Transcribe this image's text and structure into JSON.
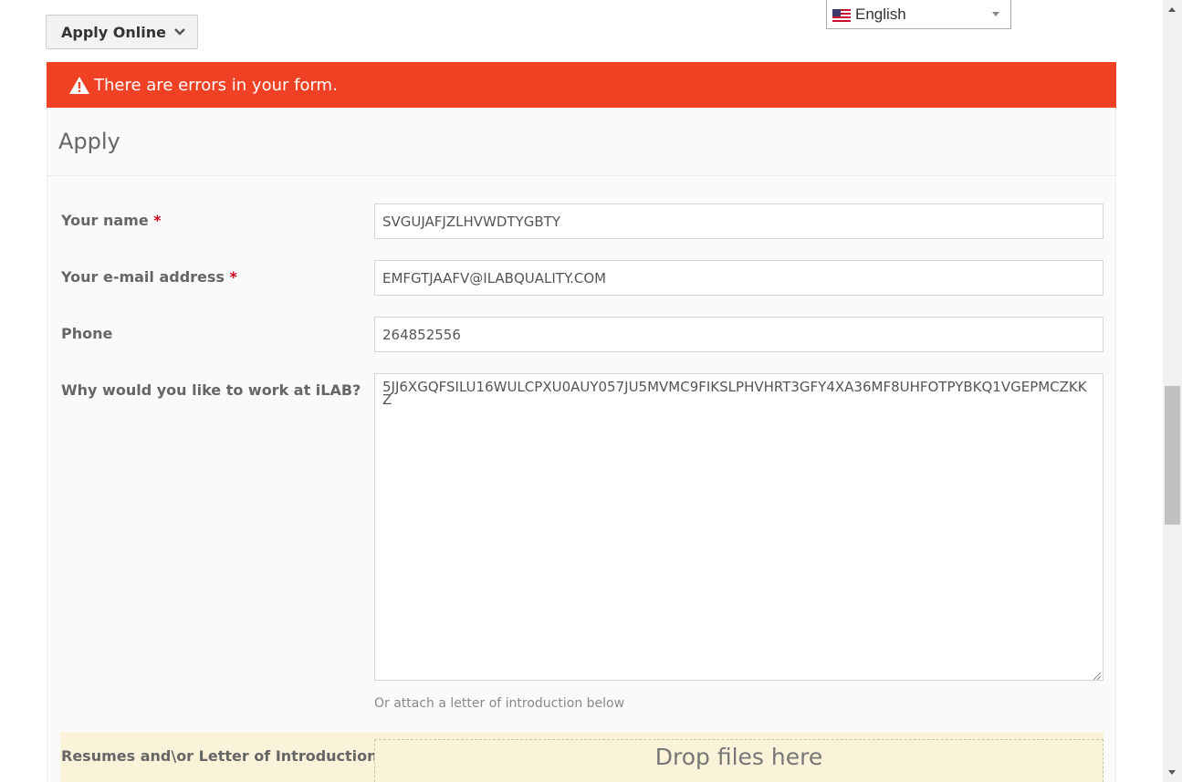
{
  "top": {
    "apply_online_label": "Apply Online",
    "language": {
      "selected": "English",
      "flag_icon": "us-flag-icon"
    }
  },
  "error": {
    "message": "There are errors in your form.",
    "color": "#f04124"
  },
  "form": {
    "title": "Apply",
    "fields": {
      "name": {
        "label": "Your name",
        "required": "*",
        "value": "SVGUJAFJZLHVWDTYGBTY"
      },
      "email": {
        "label": "Your e-mail address",
        "required": "*",
        "value": "EMFGTJAAFV@ILABQUALITY.COM"
      },
      "phone": {
        "label": "Phone",
        "value": "264852556"
      },
      "why": {
        "label": "Why would you like to work at iLAB?",
        "value": "5JJ6XGQFSILU16WULCPXU0AUY057JU5MVMC9FIKSLPHVHRT3GFY4XA36MF8UHFOTPYBKQ1VGEPMCZKKZ"
      }
    },
    "attach_hint": "Or attach a letter of introduction below",
    "upload": {
      "label": "Resumes and\\or Letter of Introduction?",
      "required": "*",
      "dropzone_text": "Drop files here"
    }
  }
}
